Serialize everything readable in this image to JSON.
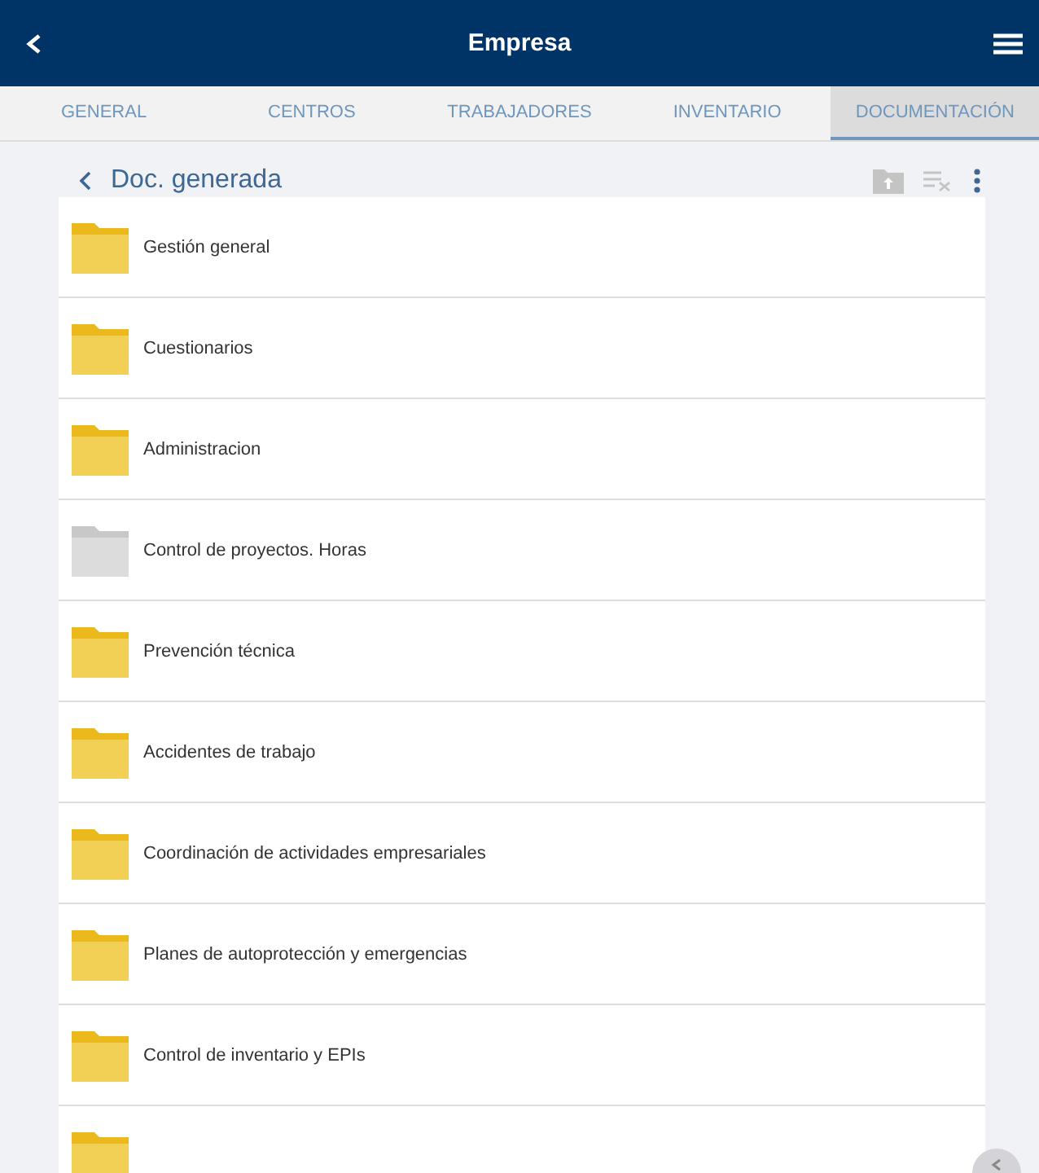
{
  "app_bar": {
    "title": "Empresa"
  },
  "tabs": [
    {
      "label": "GENERAL",
      "selected": false
    },
    {
      "label": "CENTROS",
      "selected": false
    },
    {
      "label": "TRABAJADORES",
      "selected": false
    },
    {
      "label": "INVENTARIO",
      "selected": false
    },
    {
      "label": "DOCUMENTACIÓN",
      "selected": true
    }
  ],
  "folder_header": {
    "title": "Doc. generada"
  },
  "folders": [
    {
      "name": "Gestión general",
      "disabled": false
    },
    {
      "name": "Cuestionarios",
      "disabled": false
    },
    {
      "name": "Administracion",
      "disabled": false
    },
    {
      "name": "Control de proyectos. Horas",
      "disabled": true
    },
    {
      "name": "Prevención técnica",
      "disabled": false
    },
    {
      "name": "Accidentes de trabajo",
      "disabled": false
    },
    {
      "name": "Coordinación de actividades empresariales",
      "disabled": false
    },
    {
      "name": "Planes de autoprotección y emergencias",
      "disabled": false
    },
    {
      "name": "Control de inventario y EPIs",
      "disabled": false
    },
    {
      "disabled": false
    }
  ]
}
